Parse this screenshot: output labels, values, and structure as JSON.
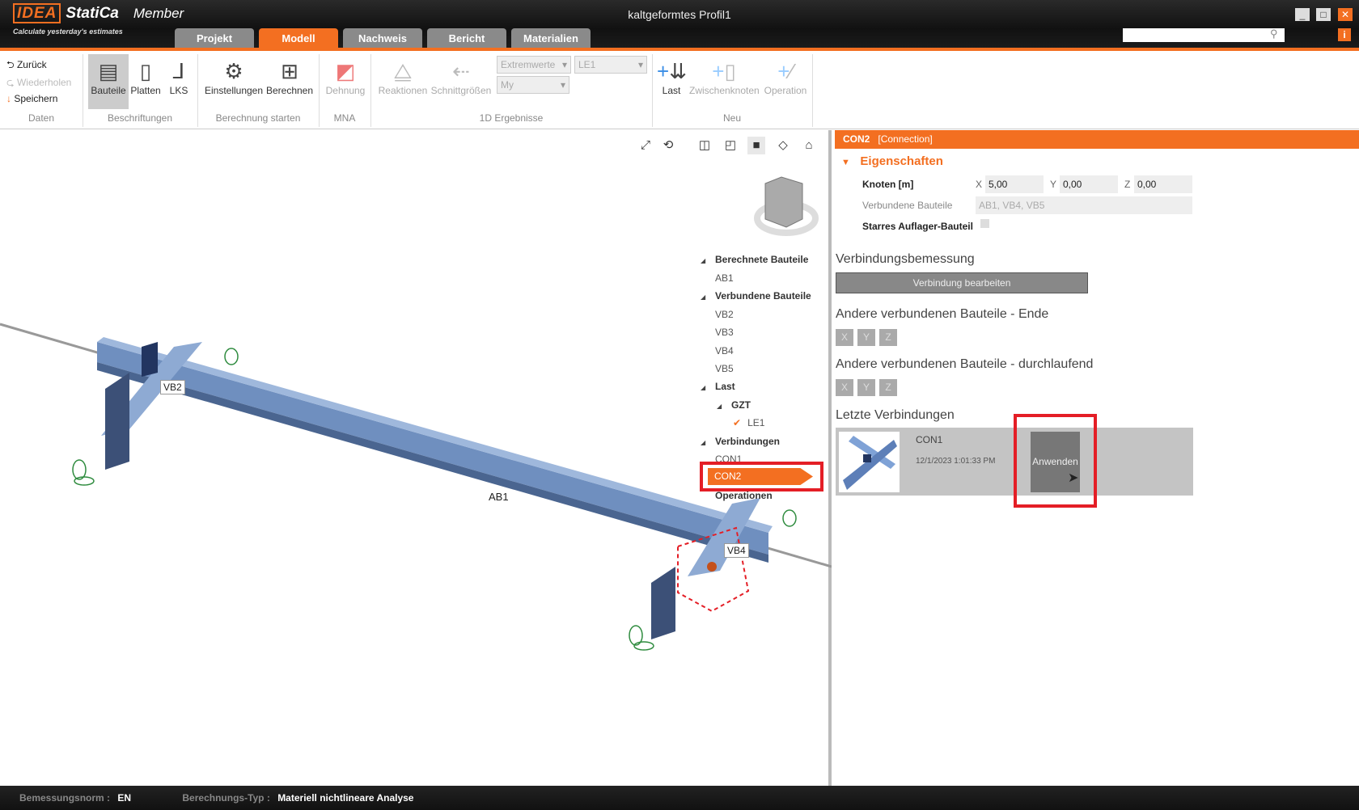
{
  "app": {
    "logo_text": "IDEA StatiCa",
    "product": "Member",
    "tagline": "Calculate yesterday's estimates",
    "window_title": "kaltgeformtes Profil1"
  },
  "tabs": [
    {
      "label": "Projekt"
    },
    {
      "label": "Modell"
    },
    {
      "label": "Nachweis"
    },
    {
      "label": "Bericht"
    },
    {
      "label": "Materialien"
    }
  ],
  "search": {
    "placeholder": ""
  },
  "ribbon": {
    "history": {
      "undo": "Zurück",
      "redo": "Wiederholen",
      "save": "Speichern",
      "group": "Daten"
    },
    "labels": {
      "bauteile": "Bauteile",
      "platten": "Platten",
      "lks": "LKS",
      "group": "Beschriftungen"
    },
    "calc": {
      "settings": "Einstellungen",
      "calculate": "Berechnen",
      "group": "Berechnung starten"
    },
    "mna": {
      "strain": "Dehnung",
      "group": "MNA"
    },
    "results": {
      "reactions": "Reaktionen",
      "forces": "Schnittgrößen",
      "dd1": "Extremwerte",
      "dd2": "LE1",
      "dd3": "My",
      "group": "1D Ergebnisse"
    },
    "new": {
      "load": "Last",
      "node": "Zwischenknoten",
      "operation": "Operation",
      "group": "Neu"
    }
  },
  "tree": {
    "computed": "Berechnete Bauteile",
    "computed_items": [
      "AB1"
    ],
    "connected": "Verbundene Bauteile",
    "connected_items": [
      "VB2",
      "VB3",
      "VB4",
      "VB5"
    ],
    "load": "Last",
    "gzt": "GZT",
    "le1": "LE1",
    "connections": "Verbindungen",
    "con1": "CON1",
    "con2": "CON2",
    "operations": "Operationen"
  },
  "scene": {
    "vb2": "VB2",
    "ab1": "AB1",
    "vb4": "VB4"
  },
  "panel": {
    "title": "CON2",
    "subtitle": "[Connection]",
    "properties": "Eigenschaften",
    "node_label": "Knoten [m]",
    "x_label": "X",
    "x": "5,00",
    "y_label": "Y",
    "y": "0,00",
    "z_label": "Z",
    "z": "0,00",
    "members_label": "Verbundene Bauteile",
    "members": "AB1, VB4, VB5",
    "rigid_label": "Starres Auflager-Bauteil",
    "rigid_checked": false,
    "design_heading": "Verbindungsbemessung",
    "edit_button": "Verbindung bearbeiten",
    "end_heading": "Andere verbundenen Bauteile - Ende",
    "cont_heading": "Andere verbundenen Bauteile - durchlaufend",
    "axes": [
      "X",
      "Y",
      "Z"
    ],
    "recent_heading": "Letzte Verbindungen",
    "recent": {
      "name": "CON1",
      "date": "12/1/2023 1:01:33 PM",
      "apply": "Anwenden"
    }
  },
  "status": {
    "norm_label": "Bemessungsnorm :",
    "norm": "EN",
    "type_label": "Berechnungs-Typ :",
    "type": "Materiell nichtlineare Analyse"
  },
  "colors": {
    "accent": "#f36f21",
    "highlight": "#e41e26",
    "steel": "#6f8fbf"
  }
}
